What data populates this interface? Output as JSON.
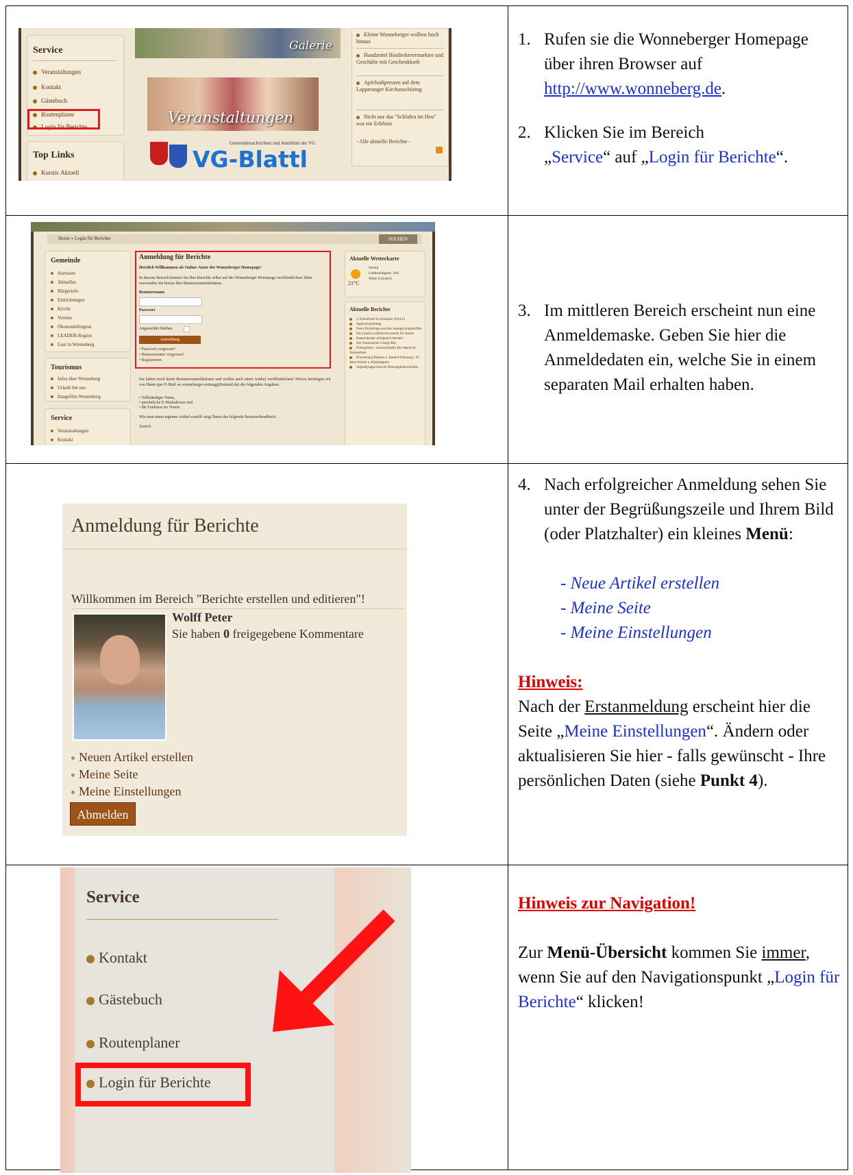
{
  "row1": {
    "shot": {
      "service_heading": "Service",
      "service_items": [
        "Veranstaltungen",
        "Kontakt",
        "Gästebuch",
        "Routenplaner",
        "Login für Berichte"
      ],
      "toplinks_heading": "Top Links",
      "toplinks_items": [
        "Kurstic Aktuell"
      ],
      "galerie_label": "Galerie",
      "veranstaltungen_label": "Veranstaltungen",
      "vgblatt_sub": "Gemeindenachrichten und Amtsblatt der VG",
      "vgblatt_title": "VG-Blattl",
      "news": [
        "Kleine Wonneberger wollten hoch hinaus",
        "Handzettel Biodirektvermarkter und Geschäfte mit Geschenkkorb",
        "Apfelsaftpressen auf dem Lapperanger Kirchanschöring",
        "Nicht nur das \"Schlafen im Heu\" war ein Erlebnis"
      ],
      "news_all": "- Alle aktuelle Berichte -"
    },
    "step1_num": "1.",
    "step1_a": "Rufen sie die Wonneberger Homepage über ihren Browser auf ",
    "step1_link": "http://www.wonneberg.de",
    "step1_end": ".",
    "step2_num": "2.",
    "step2_a": "Klicken Sie im Bereich ",
    "step2_q1": "„",
    "step2_service": "Service",
    "step2_b": "“ auf  „",
    "step2_login": "Login für Berichte",
    "step2_end": "“."
  },
  "row2": {
    "shot": {
      "breadcrumb": "Home » Login für Berichte",
      "search_label": "SUCHEN",
      "gemeinde_heading": "Gemeinde",
      "gemeinde_items": [
        "Startseite",
        "Aktuelles",
        "Bürgerinfo",
        "Einrichtungen",
        "Kirche",
        "Vereine",
        "Ökomodellregion",
        "LEADER-Region",
        "Gast in Wonneberg"
      ],
      "tourismus_heading": "Tourismus",
      "tourismus_items": [
        "Infos über Wonneberg",
        "Urlaub bei uns",
        "Imagefilm Wonneberg"
      ],
      "service_heading": "Service",
      "service_items": [
        "Veranstaltungen",
        "Kontakt"
      ],
      "login_title": "Anmeldung für Berichte",
      "login_welcome": "Herzlich Willkommen als Online-Autor der Wonneberger Homepage!",
      "login_intro": "In diesem Bereich können Sie Ihre Berichte selbst auf der Wonneberger Homepage veröffentlichen! Bitte verwenden Sie hierzu Ihre Benutzeranmeldedaten.",
      "username_label": "Benutzername",
      "password_label": "Passwort",
      "remember_label": "Angemeldet bleiben",
      "login_button": "Anmeldung",
      "login_links": [
        "Passwort vergessen?",
        "Benutzername vergessen?",
        "Registrieren"
      ],
      "below_text": "Sie haben noch keine Benutzeranmeldedaten und wollen auch einen Artikel veröffentlichen? Hierzu benötigen wir von Ihnen (per E-Mail an wonneberger-zeitung@hotmail.de) die folgenden Angaben:",
      "below_list": [
        "Vollständiger Name,",
        "persönliche E-Mailadresse und",
        "die Funktion im Verein."
      ],
      "below_text2": "Wie man einen eigenen Artikel erstellt zeigt Ihnen das folgende Benutzerhandbuch.",
      "back_link": "Zurück",
      "weather_heading": "Aktuelle Wetterkarte",
      "weather_cond": "Sonnig",
      "weather_humidity": "Luftfeuchtigkeit: 24%",
      "weather_wind": "Wind: 8.44 km/h",
      "weather_temp": "21°C",
      "reports_heading": "Aktuelle Berichte",
      "reports": [
        "3. Elternbrief im Schuljahr 2014/15",
        "Jagdversammlung",
        "Neun Flüchtlinge aus dem Senegal eingetroffen",
        "Die Leada Laubfrösche basteln für Ostern",
        "Bauerntheater erfolgreich beendet",
        "Der Traunsteiner Georgi-Ritt",
        "Probegrillen - schmackhaftes Bio-Menü für Vereinsfeste",
        "Einweihung Rathaus u. Bauhof-Fahrzeug / 20 Jahre Schule u. Kindergarten",
        "Jugendgruppe besucht Rettungshubschrauber"
      ]
    },
    "step3_num": "3.",
    "step3_text": "Im mittleren Bereich erscheint nun eine Anmeldemaske. Geben Sie hier die Anmeldedaten ein, welche Sie in einem separaten Mail erhalten haben."
  },
  "row3": {
    "shot": {
      "title": "Anmeldung für Berichte",
      "welcome": "Willkommen im Bereich \"Berichte erstellen und editieren\"!",
      "user_name": "Wolff Peter",
      "comments_pre": "Sie haben ",
      "comments_count": "0",
      "comments_post": " freigegebene Kommentare",
      "menu": [
        "Neuen Artikel erstellen",
        "Meine Seite",
        "Meine Einstellungen"
      ],
      "logout_button": "Abmelden"
    },
    "step4_num": "4.",
    "step4_text": "Nach erfolgreicher Anmeldung sehen Sie unter der Begrüßungszeile und  Ihrem Bild (oder Platzhalter) ein kleines ",
    "step4_bold": "Menü",
    "step4_colon": ":",
    "menu_items": [
      "- Neue Artikel erstellen",
      "- Meine Seite",
      "- Meine Einstellungen"
    ],
    "hint_title": "Hinweis:",
    "hint_a": "Nach der ",
    "hint_ul": "Erstanmeldung",
    "hint_b": " erscheint hier die Seite „",
    "hint_link": "Meine Einstellungen",
    "hint_c": "“. Ändern oder aktualisieren Sie hier - falls gewünscht - Ihre persönlichen Daten (siehe ",
    "hint_bold": "Punkt 4",
    "hint_d": ")."
  },
  "row4": {
    "shot": {
      "heading": "Service",
      "items": [
        "Kontakt",
        "Gästebuch",
        "Routenplaner",
        "Login für Berichte"
      ]
    },
    "nav_title": "Hinweis zur Navigation!",
    "nav_a": "Zur ",
    "nav_bold": "Menü-Übersicht",
    "nav_b": " kommen Sie ",
    "nav_ul": "immer",
    "nav_c": ", wenn Sie auf den Navigationspunkt  „",
    "nav_link": "Login für Berichte",
    "nav_d": "“ klicken!"
  },
  "colors": {
    "link_blue": "#1a2fd6",
    "hint_red": "#e10000",
    "highlight_red": "#ff1212",
    "button_brown": "#9e5418"
  }
}
